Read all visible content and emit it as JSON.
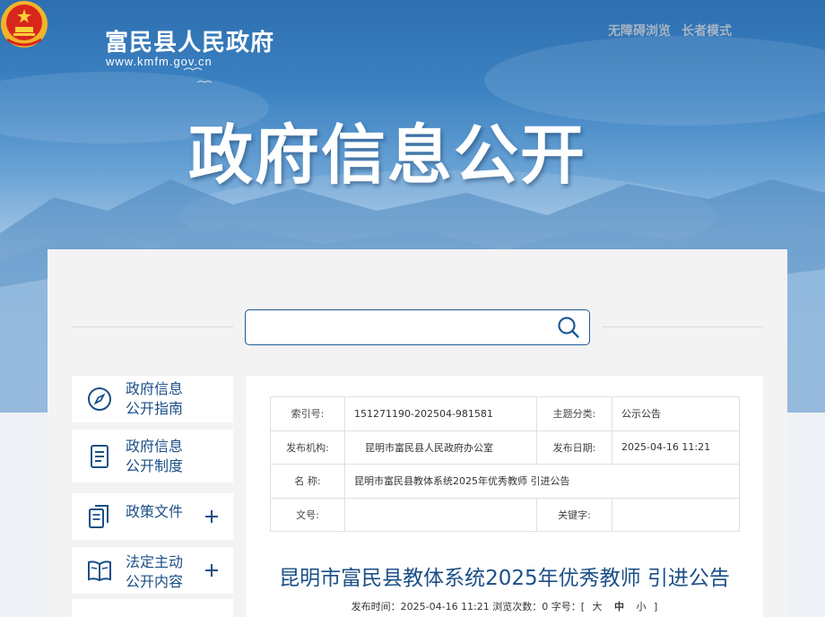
{
  "header": {
    "site_name": "富民县人民政府",
    "site_url": "www.kmfm.gov.cn",
    "links": [
      "无障碍浏览",
      "长者模式"
    ],
    "hero_title": "政府信息公开"
  },
  "search": {
    "placeholder": "",
    "value": ""
  },
  "sidebar": {
    "items": [
      {
        "label_line1": "政府信息",
        "label_line2": "公开指南",
        "icon": "compass-icon",
        "expandable": false
      },
      {
        "label_line1": "政府信息",
        "label_line2": "公开制度",
        "icon": "document-icon",
        "expandable": false
      },
      {
        "label_line1": "政策文件",
        "label_line2": "",
        "icon": "files-icon",
        "expandable": true
      },
      {
        "label_line1": "法定主动",
        "label_line2": "公开内容",
        "icon": "book-icon",
        "expandable": true
      }
    ]
  },
  "meta": {
    "index_label": "索引号:",
    "index_value": "151271190-202504-981581",
    "topic_label": "主题分类:",
    "topic_value": "公示公告",
    "org_label": "发布机构:",
    "org_value": "昆明市富民县人民政府办公室",
    "date_label": "发布日期:",
    "date_value": "2025-04-16 11:21",
    "name_label": "名 称:",
    "name_value": "昆明市富民县教体系统2025年优秀教师 引进公告",
    "docno_label": "文号:",
    "docno_value": "",
    "keyword_label": "关键字:",
    "keyword_value": ""
  },
  "document": {
    "title": "昆明市富民县教体系统2025年优秀教师 引进公告",
    "info_prefix": "发布时间：2025-04-16 11:21 浏览次数：0 字号：[",
    "size_large": "大",
    "size_medium": "中",
    "size_small": "小",
    "info_suffix": "]"
  },
  "colors": {
    "accent": "#1b4f87",
    "banner": "#3c82c2"
  }
}
